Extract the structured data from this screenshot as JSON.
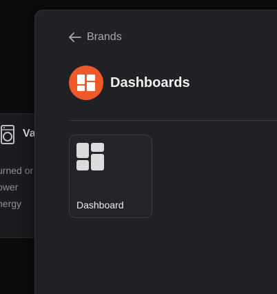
{
  "background_card": {
    "title": "Va",
    "icon": "washing-machine-icon",
    "lines": [
      "urned or",
      "ower",
      "nergy"
    ]
  },
  "panel": {
    "back_label": "Brands",
    "back_icon": "arrow-left-icon",
    "title": "Dashboards",
    "brand_icon": "dashboard-grid-icon",
    "brand_color": "#f05a2b",
    "tiles": [
      {
        "label": "Dashboard",
        "icon": "dashboard-grid-icon"
      }
    ]
  }
}
